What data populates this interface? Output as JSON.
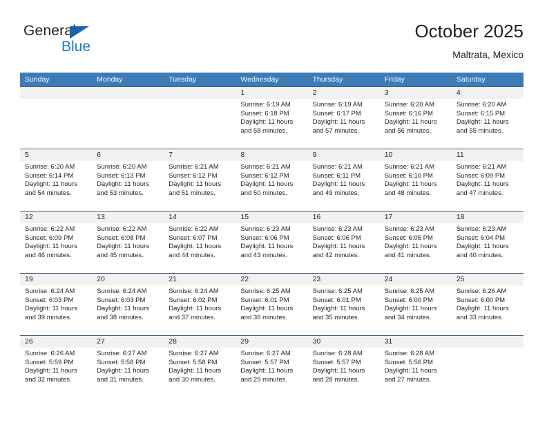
{
  "logo": {
    "primary_text": "General",
    "secondary_text": "Blue",
    "primary_color": "#231f20",
    "secondary_color": "#1a7cc4",
    "triangle_color": "#1565a8"
  },
  "header": {
    "title": "October 2025",
    "subtitle": "Maltrata, Mexico"
  },
  "theme": {
    "header_bar_color": "#3b7bb8",
    "daynum_strip_color": "#f1f1f1",
    "row_border_color": "#44617d",
    "text_color": "#231f20"
  },
  "weekdays": [
    "Sunday",
    "Monday",
    "Tuesday",
    "Wednesday",
    "Thursday",
    "Friday",
    "Saturday"
  ],
  "weeks": [
    [
      {
        "day": "",
        "sunrise": "",
        "sunset": "",
        "daylight": ""
      },
      {
        "day": "",
        "sunrise": "",
        "sunset": "",
        "daylight": ""
      },
      {
        "day": "",
        "sunrise": "",
        "sunset": "",
        "daylight": ""
      },
      {
        "day": "1",
        "sunrise": "Sunrise: 6:19 AM",
        "sunset": "Sunset: 6:18 PM",
        "daylight": "Daylight: 11 hours and 58 minutes."
      },
      {
        "day": "2",
        "sunrise": "Sunrise: 6:19 AM",
        "sunset": "Sunset: 6:17 PM",
        "daylight": "Daylight: 11 hours and 57 minutes."
      },
      {
        "day": "3",
        "sunrise": "Sunrise: 6:20 AM",
        "sunset": "Sunset: 6:16 PM",
        "daylight": "Daylight: 11 hours and 56 minutes."
      },
      {
        "day": "4",
        "sunrise": "Sunrise: 6:20 AM",
        "sunset": "Sunset: 6:15 PM",
        "daylight": "Daylight: 11 hours and 55 minutes."
      }
    ],
    [
      {
        "day": "5",
        "sunrise": "Sunrise: 6:20 AM",
        "sunset": "Sunset: 6:14 PM",
        "daylight": "Daylight: 11 hours and 54 minutes."
      },
      {
        "day": "6",
        "sunrise": "Sunrise: 6:20 AM",
        "sunset": "Sunset: 6:13 PM",
        "daylight": "Daylight: 11 hours and 53 minutes."
      },
      {
        "day": "7",
        "sunrise": "Sunrise: 6:21 AM",
        "sunset": "Sunset: 6:12 PM",
        "daylight": "Daylight: 11 hours and 51 minutes."
      },
      {
        "day": "8",
        "sunrise": "Sunrise: 6:21 AM",
        "sunset": "Sunset: 6:12 PM",
        "daylight": "Daylight: 11 hours and 50 minutes."
      },
      {
        "day": "9",
        "sunrise": "Sunrise: 6:21 AM",
        "sunset": "Sunset: 6:11 PM",
        "daylight": "Daylight: 11 hours and 49 minutes."
      },
      {
        "day": "10",
        "sunrise": "Sunrise: 6:21 AM",
        "sunset": "Sunset: 6:10 PM",
        "daylight": "Daylight: 11 hours and 48 minutes."
      },
      {
        "day": "11",
        "sunrise": "Sunrise: 6:21 AM",
        "sunset": "Sunset: 6:09 PM",
        "daylight": "Daylight: 11 hours and 47 minutes."
      }
    ],
    [
      {
        "day": "12",
        "sunrise": "Sunrise: 6:22 AM",
        "sunset": "Sunset: 6:09 PM",
        "daylight": "Daylight: 11 hours and 46 minutes."
      },
      {
        "day": "13",
        "sunrise": "Sunrise: 6:22 AM",
        "sunset": "Sunset: 6:08 PM",
        "daylight": "Daylight: 11 hours and 45 minutes."
      },
      {
        "day": "14",
        "sunrise": "Sunrise: 6:22 AM",
        "sunset": "Sunset: 6:07 PM",
        "daylight": "Daylight: 11 hours and 44 minutes."
      },
      {
        "day": "15",
        "sunrise": "Sunrise: 6:23 AM",
        "sunset": "Sunset: 6:06 PM",
        "daylight": "Daylight: 11 hours and 43 minutes."
      },
      {
        "day": "16",
        "sunrise": "Sunrise: 6:23 AM",
        "sunset": "Sunset: 6:06 PM",
        "daylight": "Daylight: 11 hours and 42 minutes."
      },
      {
        "day": "17",
        "sunrise": "Sunrise: 6:23 AM",
        "sunset": "Sunset: 6:05 PM",
        "daylight": "Daylight: 11 hours and 41 minutes."
      },
      {
        "day": "18",
        "sunrise": "Sunrise: 6:23 AM",
        "sunset": "Sunset: 6:04 PM",
        "daylight": "Daylight: 11 hours and 40 minutes."
      }
    ],
    [
      {
        "day": "19",
        "sunrise": "Sunrise: 6:24 AM",
        "sunset": "Sunset: 6:03 PM",
        "daylight": "Daylight: 11 hours and 39 minutes."
      },
      {
        "day": "20",
        "sunrise": "Sunrise: 6:24 AM",
        "sunset": "Sunset: 6:03 PM",
        "daylight": "Daylight: 11 hours and 38 minutes."
      },
      {
        "day": "21",
        "sunrise": "Sunrise: 6:24 AM",
        "sunset": "Sunset: 6:02 PM",
        "daylight": "Daylight: 11 hours and 37 minutes."
      },
      {
        "day": "22",
        "sunrise": "Sunrise: 6:25 AM",
        "sunset": "Sunset: 6:01 PM",
        "daylight": "Daylight: 11 hours and 36 minutes."
      },
      {
        "day": "23",
        "sunrise": "Sunrise: 6:25 AM",
        "sunset": "Sunset: 6:01 PM",
        "daylight": "Daylight: 11 hours and 35 minutes."
      },
      {
        "day": "24",
        "sunrise": "Sunrise: 6:25 AM",
        "sunset": "Sunset: 6:00 PM",
        "daylight": "Daylight: 11 hours and 34 minutes."
      },
      {
        "day": "25",
        "sunrise": "Sunrise: 6:26 AM",
        "sunset": "Sunset: 6:00 PM",
        "daylight": "Daylight: 11 hours and 33 minutes."
      }
    ],
    [
      {
        "day": "26",
        "sunrise": "Sunrise: 6:26 AM",
        "sunset": "Sunset: 5:59 PM",
        "daylight": "Daylight: 11 hours and 32 minutes."
      },
      {
        "day": "27",
        "sunrise": "Sunrise: 6:27 AM",
        "sunset": "Sunset: 5:58 PM",
        "daylight": "Daylight: 11 hours and 31 minutes."
      },
      {
        "day": "28",
        "sunrise": "Sunrise: 6:27 AM",
        "sunset": "Sunset: 5:58 PM",
        "daylight": "Daylight: 11 hours and 30 minutes."
      },
      {
        "day": "29",
        "sunrise": "Sunrise: 6:27 AM",
        "sunset": "Sunset: 5:57 PM",
        "daylight": "Daylight: 11 hours and 29 minutes."
      },
      {
        "day": "30",
        "sunrise": "Sunrise: 6:28 AM",
        "sunset": "Sunset: 5:57 PM",
        "daylight": "Daylight: 11 hours and 28 minutes."
      },
      {
        "day": "31",
        "sunrise": "Sunrise: 6:28 AM",
        "sunset": "Sunset: 5:56 PM",
        "daylight": "Daylight: 11 hours and 27 minutes."
      },
      {
        "day": "",
        "sunrise": "",
        "sunset": "",
        "daylight": ""
      }
    ]
  ]
}
